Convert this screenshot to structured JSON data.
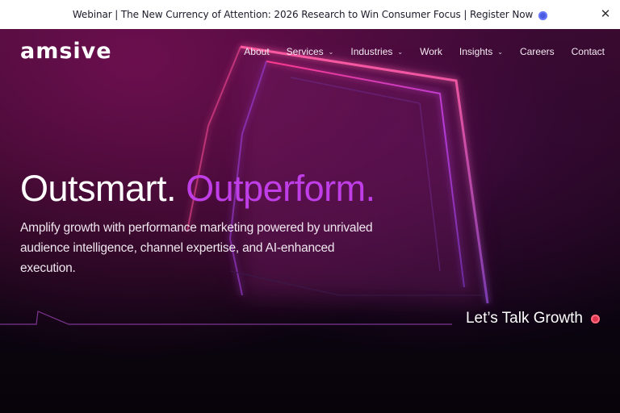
{
  "announcement": {
    "text": "Webinar | The New Currency of Attention: 2026 Research to Win Consumer Focus | Register Now",
    "close_label": "✕"
  },
  "header": {
    "logo_text": "amsive",
    "nav": [
      {
        "label": "About"
      },
      {
        "label": "Services",
        "chevron": "⌄"
      },
      {
        "label": "Industries",
        "chevron": "⌄"
      },
      {
        "label": "Work"
      },
      {
        "label": "Insights",
        "chevron": "⌄"
      },
      {
        "label": "Careers"
      },
      {
        "label": "Contact"
      }
    ]
  },
  "hero": {
    "headline_part1": "Outsmart.",
    "headline_part2": "Outperform.",
    "subtext": "Amplify growth with performance marketing powered by unrivaled audience intelligence, channel expertise, and AI-enhanced execution.",
    "cta_label": "Let’s Talk Growth"
  },
  "colors": {
    "accent_purple": "#c03ee8",
    "cta_dot": "#e0364f",
    "announce_dot": "#4b5be0"
  },
  "icons": [
    "close-icon",
    "chevron-down-icon",
    "circle-dot-icon"
  ]
}
